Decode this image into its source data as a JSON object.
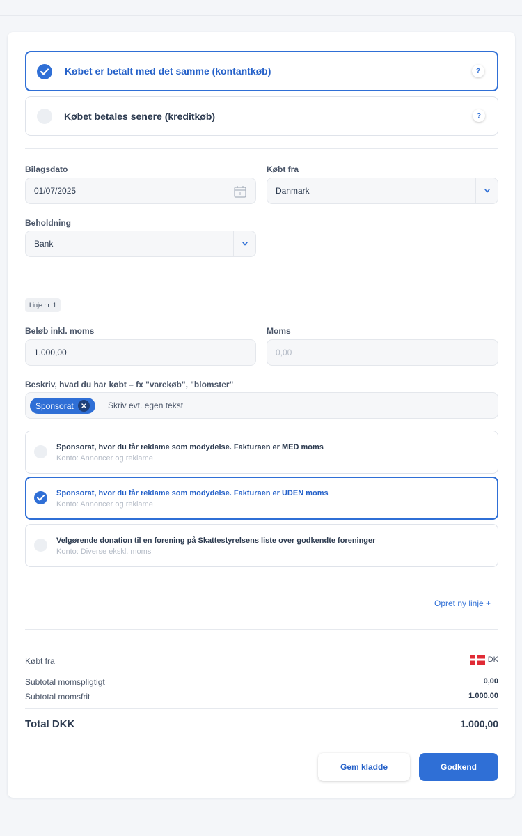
{
  "payment": {
    "cash_label": "Købet er betalt med det samme (kontantkøb)",
    "credit_label": "Købet betales senere (kreditkøb)",
    "help": "?"
  },
  "voucher": {
    "date_label": "Bilagsdato",
    "date_value": "01/07/2025",
    "bought_from_label": "Købt fra",
    "bought_from_value": "Danmark",
    "holding_label": "Beholdning",
    "holding_value": "Bank"
  },
  "line": {
    "badge": "Linje nr. 1",
    "amount_label": "Beløb inkl. moms",
    "amount_value": "1.000,00",
    "vat_label": "Moms",
    "vat_value": "0,00",
    "describe_label": "Beskriv, hvad du har købt – fx \"varekøb\", \"blomster\"",
    "tag": "Sponsorat",
    "describe_placeholder": "Skriv evt. egen tekst",
    "options": [
      {
        "title": "Sponsorat, hvor du får reklame som modydelse. Fakturaen er MED moms",
        "sub": "Konto: Annoncer og reklame",
        "selected": false
      },
      {
        "title": "Sponsorat, hvor du får reklame som modydelse. Fakturaen er UDEN moms",
        "sub": "Konto: Annoncer og reklame",
        "selected": true
      },
      {
        "title": "Velgørende donation til en forening på Skattestyrelsens liste over godkendte foreninger",
        "sub": "Konto: Diverse ekskl. moms",
        "selected": false
      }
    ],
    "new_line_link": "Opret ny linje +"
  },
  "summary": {
    "bought_from_label": "Købt fra",
    "country_code": "DK",
    "subtotal_vat_label": "Subtotal momspligtigt",
    "subtotal_vat_value": "0,00",
    "subtotal_free_label": "Subtotal momsfrit",
    "subtotal_free_value": "1.000,00",
    "total_label": "Total DKK",
    "total_value": "1.000,00"
  },
  "actions": {
    "save_draft": "Gem kladde",
    "approve": "Godkend"
  },
  "colors": {
    "accent": "#2f6fd6",
    "flag_red": "#e02b35"
  }
}
